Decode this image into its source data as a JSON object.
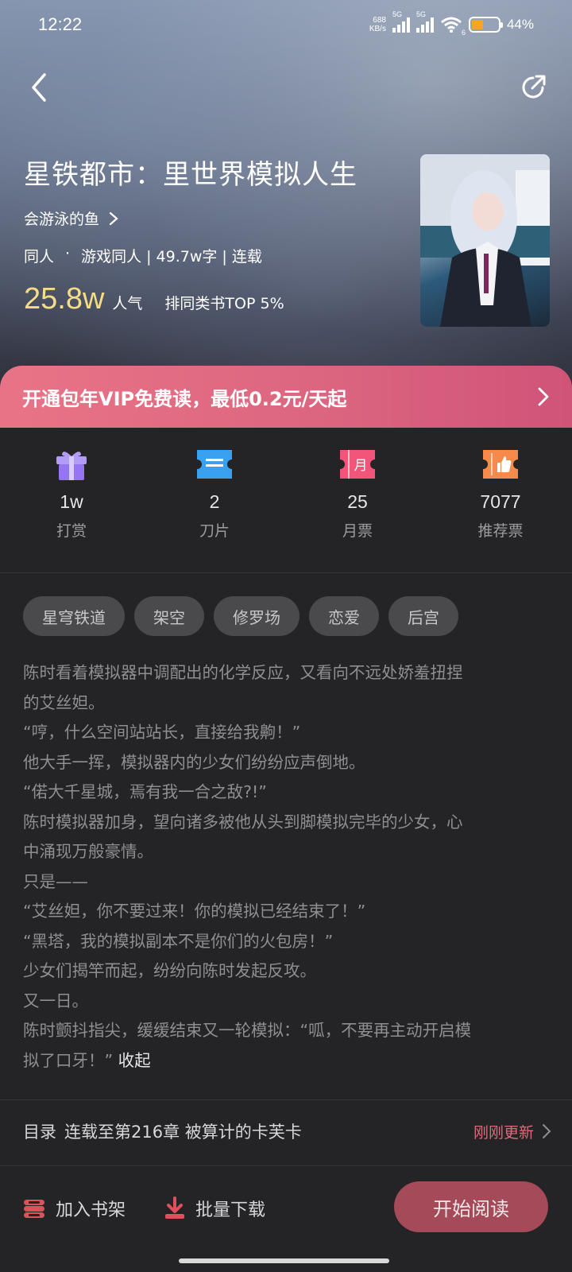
{
  "status_bar": {
    "time": "12:22",
    "net_speed_value": "688",
    "net_speed_unit": "KB/s",
    "signal1_label": "5G",
    "signal2_label": "5G",
    "wifi_label": "6",
    "battery_percent": "44%",
    "battery_level": 0.44
  },
  "nav": {
    "back_icon": "chevron-left-icon",
    "share_icon": "share-icon"
  },
  "book": {
    "title": "星铁都市：里世界模拟人生",
    "author": "会游泳的鱼",
    "category": "同人",
    "dot": "·",
    "subcategory": "游戏同人 | 49.7w字 | 连载",
    "popularity": "25.8w",
    "popularity_label": "人气",
    "rank": "排同类书TOP 5%"
  },
  "vip_banner": {
    "text": "开通包年VIP免费读，最低0.2元/天起"
  },
  "stats": [
    {
      "value": "1w",
      "label": "打赏",
      "icon": "gift-icon",
      "color": "#a78bfa"
    },
    {
      "value": "2",
      "label": "刀片",
      "icon": "ticket-icon",
      "color": "#3aa0f0"
    },
    {
      "value": "25",
      "label": "月票",
      "icon": "monthly-ticket-icon",
      "color": "#f2557a"
    },
    {
      "value": "7077",
      "label": "推荐票",
      "icon": "thumbs-up-ticket-icon",
      "color": "#f58a4a"
    }
  ],
  "tags": [
    "星穹铁道",
    "架空",
    "修罗场",
    "恋爱",
    "后宫"
  ],
  "synopsis": {
    "lines": [
      "陈时看着模拟器中调配出的化学反应，又看向不远处娇羞扭捏",
      "的艾丝妲。",
      "“哼，什么空间站站长，直接给我齁！”",
      "他大手一挥，模拟器内的少女们纷纷应声倒地。",
      "“偌大千星城，焉有我一合之敌?!”",
      "陈时模拟器加身，望向诸多被他从头到脚模拟完毕的少女，心",
      "中涌现万般豪情。",
      "只是——",
      "“艾丝妲，你不要过来！你的模拟已经结束了！”",
      "“黑塔，我的模拟副本不是你们的火包房！”",
      "少女们揭竿而起，纷纷向陈时发起反攻。",
      "又一日。",
      "陈时颤抖指尖，缓缓结束又一轮模拟：“呱，不要再主动开启模",
      "拟了口牙！”"
    ],
    "collapse": "收起"
  },
  "toc": {
    "label": "目录",
    "latest": "连载至第216章 被算计的卡芙卡",
    "update": "刚刚更新"
  },
  "bottom": {
    "shelf": "加入书架",
    "download": "批量下载",
    "read": "开始阅读"
  }
}
